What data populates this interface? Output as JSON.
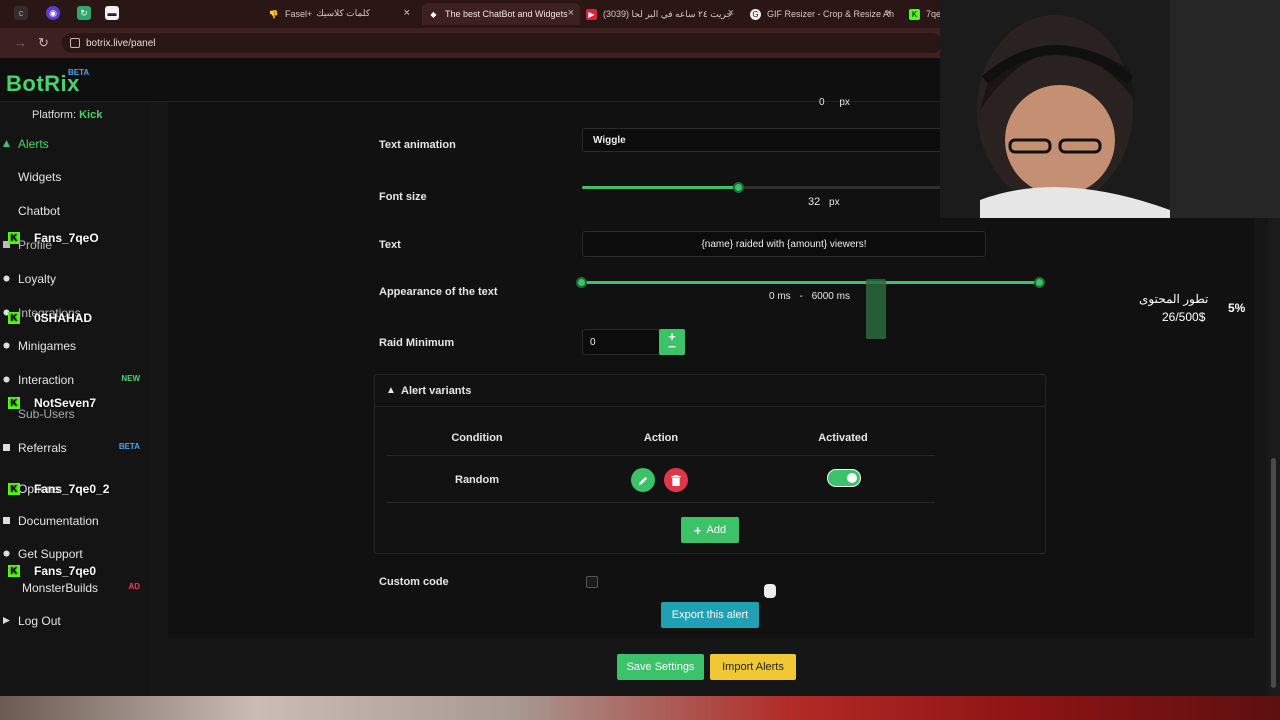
{
  "browser": {
    "tabs": [
      {
        "label": "كلمات كلاسيك",
        "close": "×"
      },
      {
        "label": "Fasel+",
        "close": "×"
      },
      {
        "label": "The best ChatBot and Widgets",
        "close": "×"
      },
      {
        "label": "(3039) جريت ٢٤ ساعه في البر لحا",
        "close": "×"
      },
      {
        "label": "GIF Resizer - Crop & Resize An",
        "close": "×"
      },
      {
        "label": "7qe",
        "close": ""
      }
    ],
    "url": "botrix.live/panel"
  },
  "app": {
    "logo": "BotRix",
    "beta": "BETA",
    "platform_label": "Platform:",
    "platform_value": "Kick"
  },
  "sidebar": {
    "items": [
      {
        "label": "Alerts"
      },
      {
        "label": "Widgets"
      },
      {
        "label": "Chatbot"
      },
      {
        "label": "Profile"
      },
      {
        "label": "Loyalty"
      },
      {
        "label": "Integrations"
      },
      {
        "label": "Minigames"
      },
      {
        "label": "Interaction",
        "badge": "NEW"
      },
      {
        "label": "Sub-Users"
      },
      {
        "label": "Referrals",
        "badge": "BETA"
      },
      {
        "label": "Options"
      },
      {
        "label": "Documentation"
      },
      {
        "label": "Get Support"
      },
      {
        "label": "MonsterBuilds",
        "badge": "AD"
      },
      {
        "label": "Log Out"
      }
    ]
  },
  "stream_overlay": {
    "chat_names": [
      "Fans_7qeO",
      "0SHAHAD",
      "NotSeven7",
      "Fans_7qe0_2",
      "Fans_7qe0"
    ],
    "donation_title": "تطور المحتوى",
    "donation_amount": "26/500$",
    "donation_percent": "5%"
  },
  "form": {
    "top_px_value": "0",
    "top_px_unit": "px",
    "text_animation_label": "Text animation",
    "text_animation_value": "Wiggle",
    "font_size_label": "Font size",
    "font_size_value": "32",
    "font_size_unit": "px",
    "font_size_fraction": 0.435,
    "text_label": "Text",
    "text_value": "{name} raided with {amount} viewers!",
    "appearance_label": "Appearance of the text",
    "appearance_start": "0",
    "appearance_start_unit": "ms",
    "appearance_sep": "-",
    "appearance_end": "6000",
    "appearance_end_unit": "ms",
    "raid_min_label": "Raid Minimum",
    "raid_min_value": "0",
    "plus": "+",
    "minus": "−",
    "custom_code_label": "Custom code"
  },
  "variants": {
    "header": "Alert variants",
    "columns": [
      "Condition",
      "Action",
      "Activated"
    ],
    "rows": [
      {
        "condition": "Random",
        "activated": true
      }
    ],
    "add_label": "Add",
    "add_icon": "+"
  },
  "buttons": {
    "export": "Export this alert",
    "save": "Save Settings",
    "import": "Import Alerts"
  },
  "colors": {
    "accent": "#3cc36a",
    "kick": "#53fc18",
    "danger": "#e0364a",
    "export": "#1fa0b4",
    "import": "#f2c832"
  }
}
